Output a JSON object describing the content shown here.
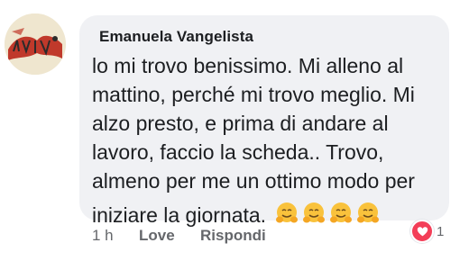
{
  "comment": {
    "author": "Emanuela Vangelista",
    "text_lines": [
      "lo mi trovo benissimo. Mi alleno al",
      "mattino, perché mi trovo meglio. Mi",
      "alzo presto, e prima di andare al",
      "lavoro, faccio la scheda.. Trovo,",
      "almeno per me un ottimo modo per",
      "iniziare la giornata."
    ],
    "emojis": [
      "hugging-face-emoji",
      "hugging-face-emoji",
      "hugging-face-emoji",
      "hugging-face-emoji"
    ]
  },
  "actions": {
    "time": "1 h",
    "love_label": "Love",
    "reply_label": "Rispondi"
  },
  "reaction": {
    "icon": "heart-icon",
    "count": "1",
    "color": "#f33e58"
  },
  "avatar": {
    "image_text": "VIVA LA VIDA"
  },
  "colors": {
    "bubble_background": "#f0f1f4",
    "text_primary": "#1c1e21",
    "text_secondary": "#65676b"
  }
}
